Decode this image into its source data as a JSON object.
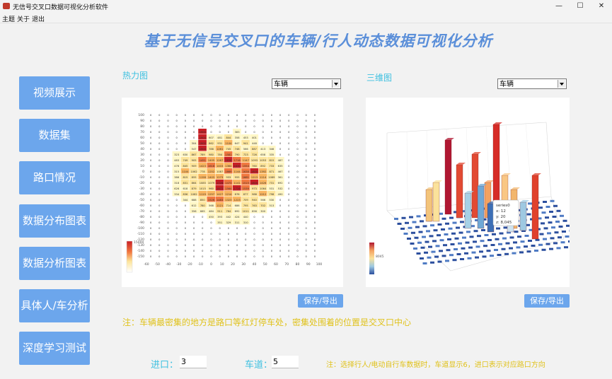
{
  "window": {
    "title": "无信号交叉口数据可视化分析软件",
    "minimize_glyph": "—",
    "maximize_glyph": "☐",
    "close_glyph": "✕"
  },
  "menu": [
    "主题",
    "关于",
    "退出"
  ],
  "header": {
    "title": "基于无信号交叉口的车辆/行人动态数据可视化分析"
  },
  "sidebar": [
    {
      "label": "视频展示"
    },
    {
      "label": "数据集"
    },
    {
      "label": "路口情况"
    },
    {
      "label": "数据分布图表"
    },
    {
      "label": "数据分析图表"
    },
    {
      "label": "具体人/车分析"
    },
    {
      "label": "深度学习测试"
    }
  ],
  "heatmap_panel": {
    "label": "热力图",
    "select_value": "车辆",
    "save_label": "保存/导出",
    "colorbar_max": "15000",
    "x_ticks": [
      "-60",
      "-50",
      "-40",
      "-30",
      "-20",
      "-10",
      "0",
      "10",
      "20",
      "30",
      "40",
      "50",
      "60",
      "70",
      "80",
      "90",
      "100"
    ],
    "y_ticks": [
      "100",
      "90",
      "80",
      "70",
      "60",
      "50",
      "40",
      "30",
      "20",
      "10",
      "0",
      "-10",
      "-20",
      "-30",
      "-40",
      "-50",
      "-60",
      "-70",
      "-80",
      "-90",
      "-100",
      "-110",
      "-120",
      "-130",
      "-140",
      "-150"
    ]
  },
  "three_d_panel": {
    "label": "三维图",
    "select_value": "车辆",
    "save_label": "保存/导出",
    "tooltip": [
      "series0",
      "x: 12",
      "y: 20",
      "z: 8,045"
    ],
    "colorbar_max": "8045"
  },
  "notes": {
    "heatmap_note": "注：车辆最密集的地方是路口等红灯停车处，密集处围着的位置是交叉口中心",
    "bottom_note": "注：选择行人/电动自行车数据时，车道显示6，进口表示对应路口方向"
  },
  "inputs": {
    "entrance_label": "进口：",
    "entrance_value": "3",
    "lane_label": "车道：",
    "lane_value": "5"
  },
  "colors": {
    "accent": "#6ca6ec",
    "label": "#3ec0e0",
    "note": "#e0c21c",
    "title": "#5b8fd9"
  }
}
